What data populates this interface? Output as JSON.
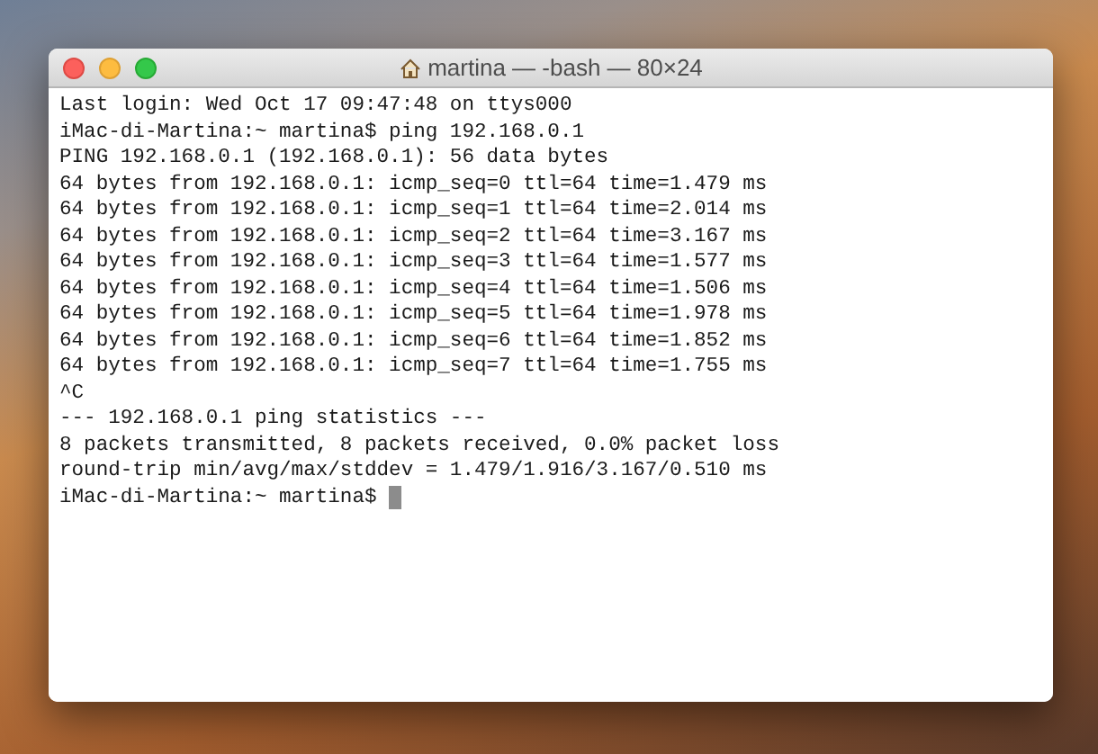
{
  "window": {
    "title": "martina — -bash — 80×24"
  },
  "terminal": {
    "lines": [
      "Last login: Wed Oct 17 09:47:48 on ttys000",
      "iMac-di-Martina:~ martina$ ping 192.168.0.1",
      "PING 192.168.0.1 (192.168.0.1): 56 data bytes",
      "64 bytes from 192.168.0.1: icmp_seq=0 ttl=64 time=1.479 ms",
      "64 bytes from 192.168.0.1: icmp_seq=1 ttl=64 time=2.014 ms",
      "64 bytes from 192.168.0.1: icmp_seq=2 ttl=64 time=3.167 ms",
      "64 bytes from 192.168.0.1: icmp_seq=3 ttl=64 time=1.577 ms",
      "64 bytes from 192.168.0.1: icmp_seq=4 ttl=64 time=1.506 ms",
      "64 bytes from 192.168.0.1: icmp_seq=5 ttl=64 time=1.978 ms",
      "64 bytes from 192.168.0.1: icmp_seq=6 ttl=64 time=1.852 ms",
      "64 bytes from 192.168.0.1: icmp_seq=7 ttl=64 time=1.755 ms",
      "^C",
      "--- 192.168.0.1 ping statistics ---",
      "8 packets transmitted, 8 packets received, 0.0% packet loss",
      "round-trip min/avg/max/stddev = 1.479/1.916/3.167/0.510 ms"
    ],
    "prompt": "iMac-di-Martina:~ martina$"
  }
}
